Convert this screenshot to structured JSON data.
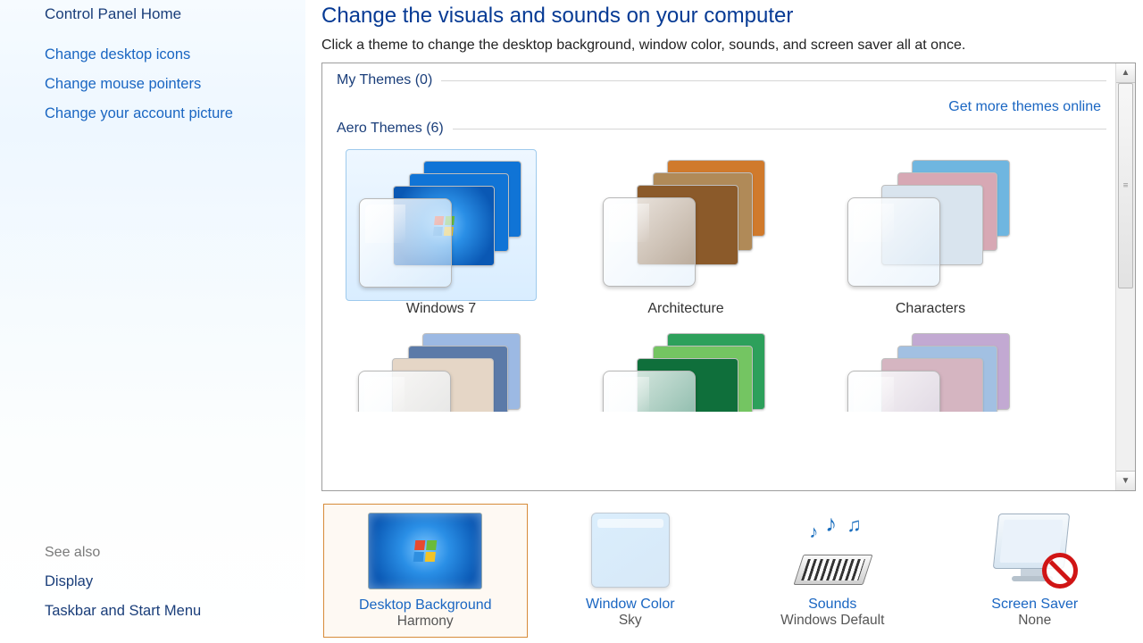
{
  "sidebar": {
    "home": "Control Panel Home",
    "links": [
      "Change desktop icons",
      "Change mouse pointers",
      "Change your account picture"
    ],
    "see_also_heading": "See also",
    "see_also": [
      "Display",
      "Taskbar and Start Menu"
    ]
  },
  "page": {
    "title": "Change the visuals and sounds on your computer",
    "subtitle": "Click a theme to change the desktop background, window color, sounds, and screen saver all at once."
  },
  "sections": {
    "my_themes": {
      "label": "My Themes",
      "count": 0
    },
    "aero_themes": {
      "label": "Aero Themes",
      "count": 6
    }
  },
  "online_link": "Get more themes online",
  "themes": [
    {
      "name": "Windows 7",
      "selected": true,
      "panes": [
        "#1074d6",
        "#1074d6",
        "#1074d6"
      ]
    },
    {
      "name": "Architecture",
      "selected": false,
      "panes": [
        "#d07a2c",
        "#b08a58",
        "#8b5a2a"
      ]
    },
    {
      "name": "Characters",
      "selected": false,
      "panes": [
        "#6fb6e0",
        "#d7a8b4",
        "#d9e4ee"
      ]
    }
  ],
  "themes_row2": [
    {
      "panes": [
        "#9cb9e3",
        "#5b7aa8",
        "#e5d6c6"
      ]
    },
    {
      "panes": [
        "#2da05b",
        "#74c562",
        "#0f6f3b"
      ]
    },
    {
      "panes": [
        "#c2a9d2",
        "#a2c0e2",
        "#d5b5c1"
      ]
    }
  ],
  "settings": {
    "desktop_background": {
      "label": "Desktop Background",
      "value": "Harmony"
    },
    "window_color": {
      "label": "Window Color",
      "value": "Sky"
    },
    "sounds": {
      "label": "Sounds",
      "value": "Windows Default"
    },
    "screen_saver": {
      "label": "Screen Saver",
      "value": "None"
    }
  }
}
